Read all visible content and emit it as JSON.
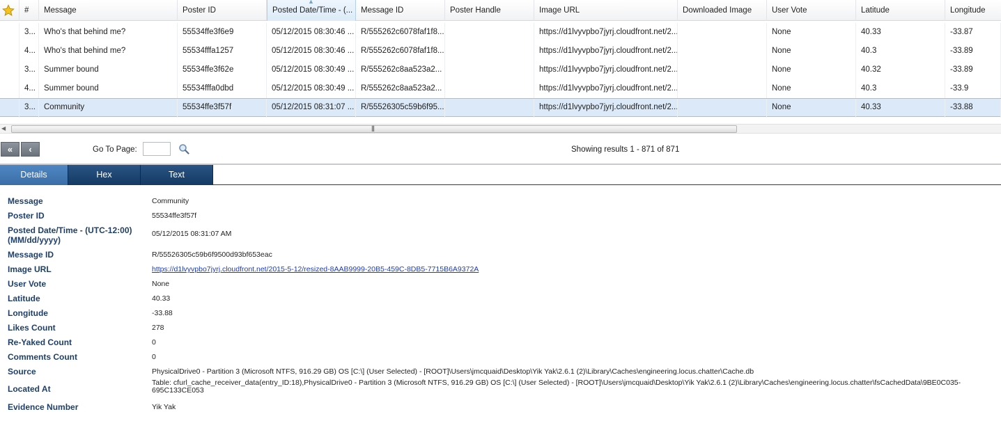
{
  "grid": {
    "columns": [
      "",
      "#",
      "Message",
      "Poster ID",
      "Posted Date/Time - (...",
      "Message ID",
      "Poster Handle",
      "Image URL",
      "Downloaded Image",
      "User Vote",
      "Latitude",
      "Longitude"
    ],
    "rows": [
      {
        "num": "3...",
        "message": "Who's that behind me?",
        "poster_id": "55534ffe3f6e9",
        "posted": "05/12/2015 08:30:46 ...",
        "message_id": "R/555262c6078faf1f8...",
        "poster_handle": "",
        "image_url": "https://d1lvyvpbo7jyrj.cloudfront.net/2...",
        "downloaded_image": "",
        "user_vote": "None",
        "latitude": "40.33",
        "longitude": "-33.87"
      },
      {
        "num": "4...",
        "message": "Who's that behind me?",
        "poster_id": "55534fffa1257",
        "posted": "05/12/2015 08:30:46 ...",
        "message_id": "R/555262c6078faf1f8...",
        "poster_handle": "",
        "image_url": "https://d1lvyvpbo7jyrj.cloudfront.net/2...",
        "downloaded_image": "",
        "user_vote": "None",
        "latitude": "40.3",
        "longitude": "-33.89"
      },
      {
        "num": "3...",
        "message": "Summer bound",
        "poster_id": "55534ffe3f62e",
        "posted": "05/12/2015 08:30:49 ...",
        "message_id": "R/555262c8aa523a2...",
        "poster_handle": "",
        "image_url": "https://d1lvyvpbo7jyrj.cloudfront.net/2...",
        "downloaded_image": "",
        "user_vote": "None",
        "latitude": "40.32",
        "longitude": "-33.89"
      },
      {
        "num": "4...",
        "message": "Summer bound",
        "poster_id": "55534fffa0dbd",
        "posted": "05/12/2015 08:30:49 ...",
        "message_id": "R/555262c8aa523a2...",
        "poster_handle": "",
        "image_url": "https://d1lvyvpbo7jyrj.cloudfront.net/2...",
        "downloaded_image": "",
        "user_vote": "None",
        "latitude": "40.3",
        "longitude": "-33.9"
      },
      {
        "num": "3...",
        "message": "Community",
        "poster_id": "55534ffe3f57f",
        "posted": "05/12/2015 08:31:07 ...",
        "message_id": "R/55526305c59b6f95...",
        "poster_handle": "",
        "image_url": "https://d1lvyvpbo7jyrj.cloudfront.net/2...",
        "downloaded_image": "",
        "user_vote": "None",
        "latitude": "40.33",
        "longitude": "-33.88"
      }
    ]
  },
  "pager": {
    "first_label": "«",
    "prev_label": "‹",
    "goto_label": "Go To Page:",
    "goto_value": "",
    "showing": "Showing results 1 - 871 of 871"
  },
  "tabs": [
    "Details",
    "Hex",
    "Text"
  ],
  "details": [
    {
      "label": "Message",
      "value": "Community"
    },
    {
      "label": "Poster ID",
      "value": "55534ffe3f57f"
    },
    {
      "label": "Posted Date/Time - (UTC-12:00)",
      "label2": "(MM/dd/yyyy)",
      "value": "05/12/2015 08:31:07 AM"
    },
    {
      "label": "Message ID",
      "value": "R/55526305c59b6f9500d93bf653eac"
    },
    {
      "label": "Image URL",
      "value": "https://d1lvyvpbo7jyrj.cloudfront.net/2015-5-12/resized-8AAB9999-20B5-459C-8DB5-7715B6A9372A",
      "link": true
    },
    {
      "label": "User Vote",
      "value": "None"
    },
    {
      "label": "Latitude",
      "value": "40.33"
    },
    {
      "label": "Longitude",
      "value": "-33.88"
    },
    {
      "label": "Likes Count",
      "value": "278"
    },
    {
      "label": "Re-Yaked Count",
      "value": "0"
    },
    {
      "label": "Comments Count",
      "value": "0"
    },
    {
      "label": "Source",
      "value": "PhysicalDrive0 - Partition 3 (Microsoft NTFS, 916.29 GB) OS [C:\\] (User Selected) - [ROOT]\\Users\\jmcquaid\\Desktop\\Yik Yak\\2.6.1 (2)\\Library\\Caches\\engineering.locus.chatter\\Cache.db"
    },
    {
      "label": "Located At",
      "value": "Table: cfurl_cache_receiver_data(entry_ID:18),PhysicalDrive0 - Partition 3 (Microsoft NTFS, 916.29 GB) OS [C:\\] (User Selected) - [ROOT]\\Users\\jmcquaid\\Desktop\\Yik Yak\\2.6.1 (2)\\Library\\Caches\\engineering.locus.chatter\\fsCachedData\\9BE0C035-",
      "value2": "695C133CE053"
    },
    {
      "label": "Evidence Number",
      "value": "Yik Yak"
    }
  ],
  "colors": {
    "accent": "#1d3f6a",
    "tab_active": "#3a6ea8",
    "tab": "#1c4473",
    "selected_row": "#dbe9f8",
    "link": "#1a3cc0"
  },
  "icons": {
    "bookmark": "star-icon",
    "search": "magnifier-icon"
  }
}
